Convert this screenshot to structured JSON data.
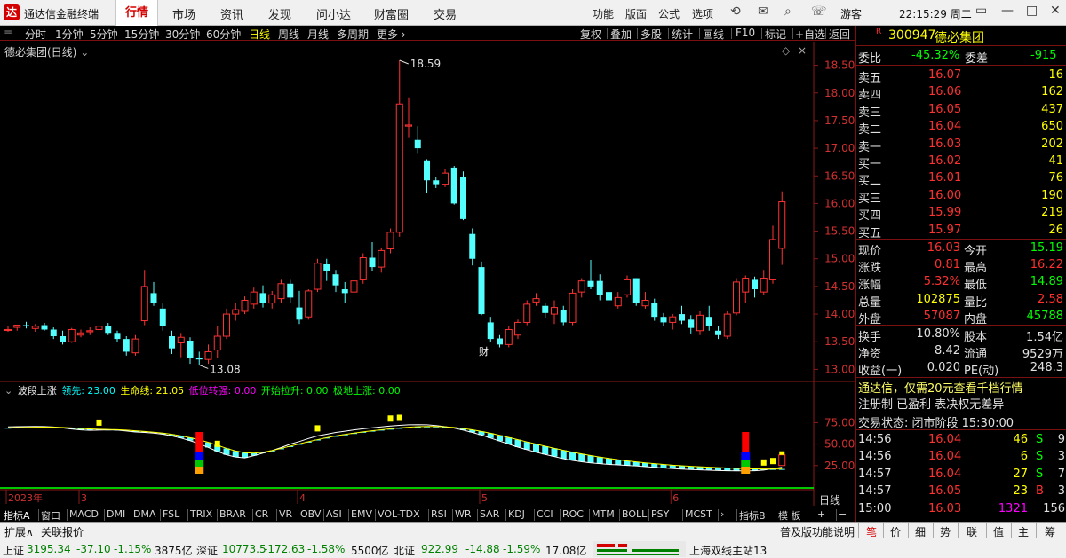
{
  "titlebar": {
    "logo": "达",
    "app_name": "通达信金融终端",
    "menu": [
      "行情",
      "市场",
      "资讯",
      "发现",
      "问小达",
      "财富圈",
      "交易"
    ],
    "right_menu": [
      "功能",
      "版面",
      "公式",
      "选项"
    ],
    "guest": "游客",
    "clock": "22:15:29 周二"
  },
  "periods": [
    "分时",
    "1分钟",
    "5分钟",
    "15分钟",
    "30分钟",
    "60分钟",
    "日线",
    "周线",
    "月线",
    "多周期",
    "更多 ›"
  ],
  "tools": [
    "复权",
    "叠加",
    "多股",
    "统计",
    "画线",
    "F10",
    "标记",
    "+自选",
    "返回"
  ],
  "main_label": "德必集团(日线)",
  "indicator": {
    "name": "波段上涨",
    "items": [
      {
        "label": "领先:",
        "value": "23.00",
        "color": "#00ffff"
      },
      {
        "label": "生命线:",
        "value": "21.05",
        "color": "#ffff00"
      },
      {
        "label": "低位转强:",
        "value": "0.00",
        "color": "#ff00ff"
      },
      {
        "label": "开始拉升:",
        "value": "0.00",
        "color": "#00ff00"
      },
      {
        "label": "极地上涨:",
        "value": "0.00",
        "color": "#00ff00"
      }
    ]
  },
  "axis_button": "日线",
  "indicator_tabs": [
    "指标A",
    "窗口",
    "MACD",
    "DMI",
    "DMA",
    "FSL",
    "TRIX",
    "BRAR",
    "CR",
    "VR",
    "OBV",
    "ASI",
    "EMV",
    "VOL-TDX",
    "RSI",
    "WR",
    "SAR",
    "KDJ",
    "CCI",
    "ROC",
    "MTM",
    "BOLL",
    "PSY",
    "MCST",
    "›",
    "指标B",
    "模 板",
    "+",
    "−"
  ],
  "expand": {
    "left": [
      "扩展∧",
      "关联报价"
    ],
    "right": [
      "普及版功能说明",
      "笔",
      "价",
      "细",
      "势",
      "联",
      "值",
      "主",
      "筹"
    ]
  },
  "status": [
    {
      "name": "上证",
      "value": "3195.34",
      "change": "-37.10",
      "pct": "-1.15%",
      "amount": "3875亿"
    },
    {
      "name": "深证",
      "value": "10773.5",
      "change": "-172.63",
      "pct": "-1.58%",
      "amount": "5500亿"
    },
    {
      "name": "北证",
      "value": "922.99",
      "change": "-14.88",
      "pct": "-1.59%",
      "amount": "17.08亿"
    }
  ],
  "server": "上海双线主站13",
  "stock": {
    "badge": "R",
    "code": "300947",
    "name": "德必集团"
  },
  "weibi": {
    "label": "委比",
    "value": "-45.32%",
    "label2": "委差",
    "value2": "-915"
  },
  "sells": [
    {
      "label": "卖五",
      "price": "16.07",
      "vol": "16"
    },
    {
      "label": "卖四",
      "price": "16.06",
      "vol": "162"
    },
    {
      "label": "卖三",
      "price": "16.05",
      "vol": "437"
    },
    {
      "label": "卖二",
      "price": "16.04",
      "vol": "650"
    },
    {
      "label": "卖一",
      "price": "16.03",
      "vol": "202"
    }
  ],
  "buys": [
    {
      "label": "买一",
      "price": "16.02",
      "vol": "41"
    },
    {
      "label": "买二",
      "price": "16.01",
      "vol": "76"
    },
    {
      "label": "买三",
      "price": "16.00",
      "vol": "190"
    },
    {
      "label": "买四",
      "price": "15.99",
      "vol": "219"
    },
    {
      "label": "买五",
      "price": "15.97",
      "vol": "26"
    }
  ],
  "quote": [
    {
      "l1": "现价",
      "v1": "16.03",
      "l2": "今开",
      "v2": "15.19",
      "c1": "#ff3030",
      "c2": "#00ff00"
    },
    {
      "l1": "涨跌",
      "v1": "0.81",
      "l2": "最高",
      "v2": "16.22",
      "c1": "#ff3030",
      "c2": "#ff3030"
    },
    {
      "l1": "涨幅",
      "v1": "5.32%",
      "l2": "最低",
      "v2": "14.89",
      "c1": "#ff3030",
      "c2": "#00ff00"
    },
    {
      "l1": "总量",
      "v1": "102875",
      "l2": "量比",
      "v2": "2.58",
      "c1": "#ffff00",
      "c2": "#ff3030"
    },
    {
      "l1": "外盘",
      "v1": "57087",
      "l2": "内盘",
      "v2": "45788",
      "c1": "#ff3030",
      "c2": "#00ff00"
    }
  ],
  "fin": [
    {
      "l1": "换手",
      "v1": "10.80%",
      "l2": "股本",
      "v2": "1.54亿"
    },
    {
      "l1": "净资",
      "v1": "8.42",
      "l2": "流通",
      "v2": "9529万"
    },
    {
      "l1": "收益(一)",
      "v1": "0.020",
      "l2": "PE(动)",
      "v2": "248.3"
    }
  ],
  "ad": "通达信，仅需20元查看千档行情",
  "reg": "注册制 已盈利 表决权无差异",
  "trade_state": "交易状态: 闭市阶段 15:30:00",
  "ticks": [
    {
      "t": "14:56",
      "p": "16.04",
      "v": "46",
      "bs": "S",
      "n": "9"
    },
    {
      "t": "14:56",
      "p": "16.04",
      "v": "6",
      "bs": "S",
      "n": "3"
    },
    {
      "t": "14:57",
      "p": "16.04",
      "v": "27",
      "bs": "S",
      "n": "7"
    },
    {
      "t": "14:57",
      "p": "16.05",
      "v": "23",
      "bs": "B",
      "n": "3"
    },
    {
      "t": "15:00",
      "p": "16.03",
      "v": "1321",
      "bs": "",
      "n": "156"
    }
  ],
  "chart_data": {
    "type": "candlestick",
    "y_ticks": [
      "18.50",
      "18.00",
      "17.50",
      "17.00",
      "16.50",
      "16.00",
      "15.50",
      "15.00",
      "14.50",
      "14.00",
      "13.50",
      "13.00"
    ],
    "y_min": 13.0,
    "y_max": 18.5,
    "high_label": "18.59",
    "low_label": "13.08",
    "annotation": "财",
    "x_labels": [
      {
        "label": "2023年",
        "i": 0
      },
      {
        "label": "3",
        "i": 8
      },
      {
        "label": "4",
        "i": 32
      },
      {
        "label": "5",
        "i": 52
      },
      {
        "label": "6",
        "i": 73
      }
    ],
    "candles": [
      [
        13.72,
        13.78,
        13.68,
        13.72
      ],
      [
        13.76,
        13.8,
        13.7,
        13.8
      ],
      [
        13.8,
        13.86,
        13.74,
        13.78
      ],
      [
        13.74,
        13.82,
        13.68,
        13.78
      ],
      [
        13.8,
        13.84,
        13.7,
        13.72
      ],
      [
        13.72,
        13.76,
        13.55,
        13.6
      ],
      [
        13.6,
        13.7,
        13.45,
        13.5
      ],
      [
        13.5,
        13.75,
        13.48,
        13.72
      ],
      [
        13.62,
        13.72,
        13.58,
        13.66
      ],
      [
        13.68,
        13.76,
        13.62,
        13.7
      ],
      [
        13.72,
        13.82,
        13.68,
        13.78
      ],
      [
        13.78,
        13.84,
        13.62,
        13.66
      ],
      [
        13.66,
        13.7,
        13.5,
        13.55
      ],
      [
        13.55,
        13.6,
        13.25,
        13.32
      ],
      [
        13.3,
        13.62,
        13.25,
        13.55
      ],
      [
        13.88,
        14.8,
        13.8,
        14.5
      ],
      [
        14.38,
        14.58,
        14.15,
        14.2
      ],
      [
        14.1,
        14.2,
        13.7,
        13.78
      ],
      [
        13.6,
        13.7,
        13.28,
        13.38
      ],
      [
        13.48,
        13.66,
        13.22,
        13.58
      ],
      [
        13.52,
        13.58,
        13.1,
        13.2
      ],
      [
        13.2,
        13.32,
        13.08,
        13.18
      ],
      [
        13.18,
        13.45,
        13.1,
        13.32
      ],
      [
        13.35,
        13.78,
        13.2,
        13.6
      ],
      [
        13.6,
        14.1,
        13.55,
        14.0
      ],
      [
        14.0,
        14.2,
        13.88,
        14.08
      ],
      [
        14.05,
        14.32,
        14.0,
        14.25
      ],
      [
        14.18,
        14.48,
        14.1,
        14.4
      ],
      [
        14.38,
        14.52,
        14.12,
        14.2
      ],
      [
        14.2,
        14.42,
        14.1,
        14.35
      ],
      [
        14.28,
        14.62,
        14.2,
        14.55
      ],
      [
        14.55,
        14.62,
        14.2,
        14.3
      ],
      [
        14.12,
        14.42,
        13.82,
        13.9
      ],
      [
        13.95,
        14.45,
        13.9,
        14.42
      ],
      [
        14.45,
        15.0,
        14.4,
        14.92
      ],
      [
        14.9,
        15.0,
        14.6,
        14.78
      ],
      [
        14.72,
        14.8,
        14.4,
        14.52
      ],
      [
        14.45,
        14.58,
        14.2,
        14.38
      ],
      [
        14.4,
        14.82,
        14.35,
        14.6
      ],
      [
        14.62,
        15.1,
        14.55,
        15.02
      ],
      [
        15.02,
        15.3,
        14.78,
        14.85
      ],
      [
        14.85,
        15.2,
        14.75,
        15.15
      ],
      [
        15.18,
        15.55,
        15.1,
        15.48
      ],
      [
        15.48,
        18.59,
        15.4,
        17.8
      ],
      [
        17.4,
        17.92,
        17.2,
        17.42
      ],
      [
        17.15,
        17.4,
        16.9,
        17.0
      ],
      [
        16.78,
        16.8,
        16.2,
        16.42
      ],
      [
        16.42,
        16.48,
        16.28,
        16.35
      ],
      [
        16.35,
        16.62,
        16.3,
        16.55
      ],
      [
        16.65,
        16.68,
        15.98,
        16.0
      ],
      [
        16.48,
        16.58,
        15.7,
        15.72
      ],
      [
        15.45,
        15.55,
        14.88,
        15.0
      ],
      [
        14.85,
        14.95,
        13.98,
        14.0
      ],
      [
        13.85,
        13.95,
        13.5,
        13.55
      ],
      [
        13.56,
        13.62,
        13.4,
        13.45
      ],
      [
        13.45,
        13.78,
        13.4,
        13.72
      ],
      [
        13.62,
        13.9,
        13.55,
        13.85
      ],
      [
        13.85,
        14.25,
        13.8,
        14.18
      ],
      [
        14.22,
        14.38,
        14.15,
        14.28
      ],
      [
        14.15,
        14.2,
        13.92,
        14.02
      ],
      [
        14.0,
        14.25,
        13.82,
        14.12
      ],
      [
        14.08,
        14.15,
        13.8,
        13.85
      ],
      [
        13.85,
        14.45,
        13.8,
        14.38
      ],
      [
        14.4,
        14.65,
        14.3,
        14.6
      ],
      [
        14.6,
        14.98,
        14.45,
        14.5
      ],
      [
        14.6,
        14.72,
        14.25,
        14.35
      ],
      [
        14.4,
        14.55,
        14.2,
        14.25
      ],
      [
        14.15,
        14.4,
        14.1,
        14.3
      ],
      [
        14.35,
        14.7,
        14.3,
        14.62
      ],
      [
        14.65,
        14.65,
        14.15,
        14.2
      ],
      [
        14.15,
        14.4,
        14.1,
        14.25
      ],
      [
        14.2,
        14.28,
        13.88,
        13.95
      ],
      [
        13.95,
        14.02,
        13.78,
        13.85
      ],
      [
        13.85,
        14.0,
        13.72,
        13.95
      ],
      [
        14.0,
        14.15,
        13.82,
        13.88
      ],
      [
        13.9,
        13.98,
        13.65,
        13.75
      ],
      [
        13.7,
        14.05,
        13.62,
        13.98
      ],
      [
        13.95,
        14.15,
        13.7,
        13.78
      ],
      [
        13.7,
        13.78,
        13.55,
        13.62
      ],
      [
        13.6,
        14.05,
        13.55,
        14.0
      ],
      [
        14.02,
        14.65,
        13.98,
        14.58
      ],
      [
        14.4,
        14.7,
        14.2,
        14.65
      ],
      [
        14.62,
        14.68,
        14.3,
        14.45
      ],
      [
        14.4,
        14.8,
        14.35,
        14.65
      ],
      [
        14.62,
        15.6,
        14.55,
        15.35
      ],
      [
        15.19,
        16.22,
        14.89,
        16.03
      ]
    ],
    "ind_y_ticks": [
      "75.00",
      "50.00",
      "25.00"
    ],
    "ind_y_min": 0,
    "ind_y_max": 100,
    "lead": [
      70.0,
      70.2,
      70.4,
      70.5,
      70.4,
      69.8,
      68.8,
      67.5,
      66.5,
      66.0,
      66.2,
      66.5,
      66.2,
      65.2,
      64.0,
      63.5,
      62.8,
      61.5,
      59.5,
      57.0,
      54.0,
      50.5,
      46.0,
      41.5,
      37.5,
      35.0,
      34.0,
      36.5,
      39.5,
      42.5,
      46.0,
      50.0,
      53.0,
      56.5,
      59.5,
      61.5,
      63.5,
      65.0,
      66.5,
      67.8,
      69.0,
      70.0,
      71.0,
      71.8,
      72.4,
      72.6,
      72.4,
      71.6,
      70.2,
      68.5,
      66.2,
      63.5,
      60.5,
      57.0,
      53.5,
      50.0,
      46.5,
      43.5,
      40.5,
      38.0,
      35.5,
      33.0,
      31.0,
      29.5,
      28.2,
      27.2,
      26.4,
      25.8,
      25.2,
      24.6,
      23.8,
      23.0,
      22.2,
      21.5,
      20.9,
      20.4,
      20.0,
      19.6,
      19.2,
      19.0,
      18.9,
      18.8,
      19.0,
      19.8,
      21.5,
      23.0
    ],
    "life": [
      69.0,
      69.2,
      69.4,
      69.6,
      69.7,
      69.6,
      69.3,
      68.8,
      68.2,
      67.7,
      67.3,
      67.0,
      66.7,
      66.2,
      65.5,
      64.7,
      63.8,
      62.7,
      61.3,
      59.6,
      57.5,
      55.0,
      52.0,
      48.6,
      45.0,
      42.0,
      40.0,
      39.5,
      40.5,
      42.5,
      45.0,
      47.6,
      50.2,
      52.8,
      55.2,
      57.5,
      59.5,
      61.2,
      62.8,
      64.2,
      65.5,
      66.7,
      67.8,
      68.8,
      69.6,
      70.2,
      70.5,
      70.5,
      70.1,
      69.3,
      68.1,
      66.6,
      64.7,
      62.6,
      60.2,
      57.7,
      55.1,
      52.5,
      50.0,
      47.5,
      45.1,
      42.8,
      40.6,
      38.6,
      36.7,
      34.9,
      33.3,
      31.8,
      30.5,
      29.3,
      28.2,
      27.2,
      26.3,
      25.5,
      24.8,
      24.2,
      23.6,
      23.1,
      22.6,
      22.2,
      21.8,
      21.5,
      21.2,
      21.0,
      21.0,
      21.05
    ],
    "markers": [
      {
        "i": 10,
        "type": "yellow"
      },
      {
        "i": 21,
        "type": "stack"
      },
      {
        "i": 23,
        "type": "yellow"
      },
      {
        "i": 34,
        "type": "yellow"
      },
      {
        "i": 42,
        "type": "yellow"
      },
      {
        "i": 43,
        "type": "yellow"
      },
      {
        "i": 81,
        "type": "stack"
      },
      {
        "i": 83,
        "type": "yellow"
      },
      {
        "i": 84,
        "type": "yellow"
      },
      {
        "i": 85,
        "type": "redbox"
      }
    ]
  }
}
